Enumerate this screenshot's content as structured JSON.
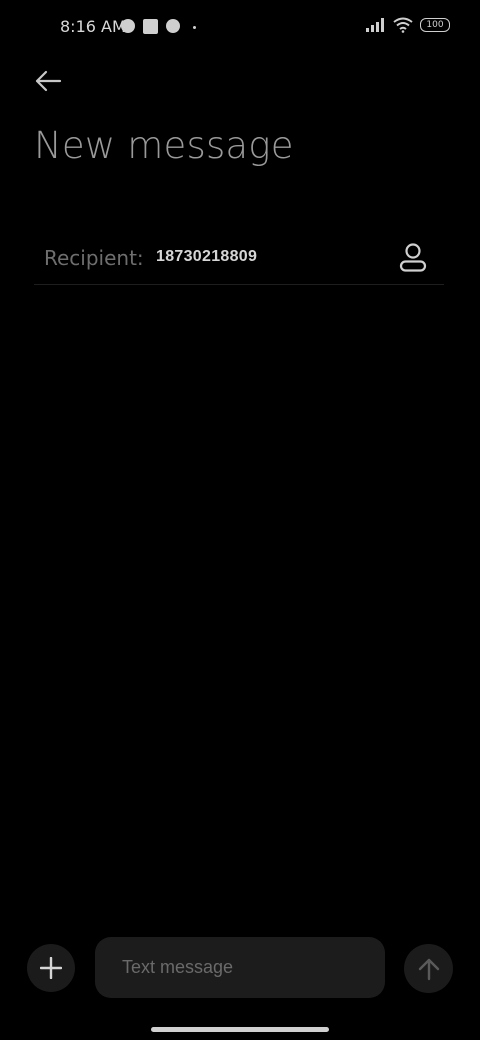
{
  "status_bar": {
    "time": "8:16 AM",
    "battery": "100",
    "icons": [
      "notification-icon",
      "notification-icon",
      "notification-icon",
      "dot-icon",
      "signal-icon",
      "wifi-icon",
      "battery-icon"
    ]
  },
  "header": {
    "back_icon": "back-arrow-icon",
    "title": "New message"
  },
  "recipient": {
    "label": "Recipient:",
    "value": "18730218809",
    "contact_icon": "person-icon"
  },
  "compose": {
    "add_icon": "plus-icon",
    "placeholder": "Text message",
    "value": "",
    "send_icon": "arrow-up-icon"
  }
}
